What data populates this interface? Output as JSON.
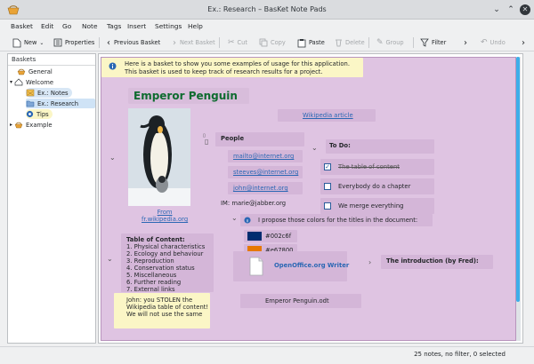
{
  "window": {
    "title": "Ex.: Research – BasKet Note Pads"
  },
  "menu": [
    "Basket",
    "Edit",
    "Go",
    "Note",
    "Tags",
    "Insert",
    "Settings",
    "Help"
  ],
  "toolbar": {
    "new": "New",
    "properties": "Properties",
    "previous_basket": "Previous Basket",
    "next_basket": "Next Basket",
    "cut": "Cut",
    "copy": "Copy",
    "paste": "Paste",
    "delete": "Delete",
    "group": "Group",
    "filter": "Filter",
    "undo": "Undo"
  },
  "sidebar": {
    "header": "Baskets",
    "items": [
      {
        "label": "General",
        "icon": "basket-icon"
      },
      {
        "label": "Welcome",
        "icon": "home-icon"
      },
      {
        "label": "Ex.: Notes",
        "icon": "notes-icon"
      },
      {
        "label": "Ex.: Research",
        "icon": "research-icon"
      },
      {
        "label": "Tips",
        "icon": "tips-icon"
      },
      {
        "label": "Example",
        "icon": "basket-icon"
      }
    ]
  },
  "basket": {
    "info_line1": "Here is a basket to show you some examples of usage for this application.",
    "info_line2": "This basket is used to keep track of research results for a project.",
    "heading": "Emperor Penguin",
    "wiki_link": "Wikipedia article",
    "image_caption_1": "From",
    "image_caption_2": "fr.wikipedia.org",
    "people_title": "People",
    "people": [
      "mailto@internet.org",
      "steeves@internet.org",
      "john@internet.org"
    ],
    "im": "IM: marie@jabber.org",
    "todo_title": "To Do:",
    "todo_items": [
      {
        "text": "The table of content",
        "checked": true
      },
      {
        "text": "Everybody do a chapter",
        "checked": false
      },
      {
        "text": "We merge everything",
        "checked": false
      }
    ],
    "colors_text": "I propose those colors for the titles in the document:",
    "color1": "#002c6f",
    "color2": "#e67800",
    "toc_title": "Table of Content:",
    "toc": [
      "1. Physical characteristics",
      "2. Ecology and behaviour",
      "3. Reproduction",
      "4. Conservation status",
      "5. Miscellaneous",
      "6. Further reading",
      "7. External links"
    ],
    "john_note": [
      "John: you STOLEN the",
      "Wikipedia table of content!",
      "We will not use the same"
    ],
    "writer_link": "OpenOffice.org Writer",
    "intro": "The introduction (by Fred):",
    "odt_file": "Emperor Penguin.odt"
  },
  "status": "25 notes, no filter, 0 selected",
  "colors": {
    "basket_bg": "#dfc4e2",
    "heading": "#0e6b2f",
    "link": "#2a67b4",
    "accent": "#3daee9"
  }
}
